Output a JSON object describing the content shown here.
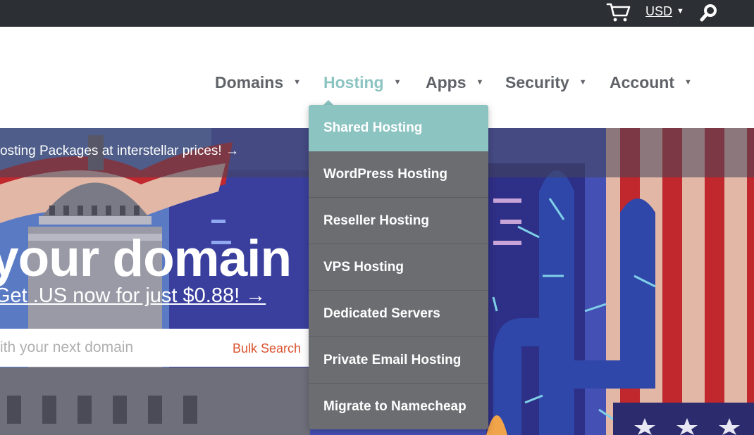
{
  "topbar": {
    "currency": "USD",
    "icons": [
      "cart-icon",
      "chevron-down-icon",
      "search-icon"
    ]
  },
  "nav": {
    "items": [
      {
        "label": "Domains"
      },
      {
        "label": "Hosting"
      },
      {
        "label": "Apps"
      },
      {
        "label": "Security"
      },
      {
        "label": "Account"
      }
    ],
    "active_index": 1
  },
  "hero": {
    "promo": "osting Packages at interstellar prices! →",
    "headline": "your domain",
    "subline": "Get .US now for just $0.88! →",
    "search_placeholder": "ith your next domain",
    "bulk_search": "Bulk Search"
  },
  "dropdown": {
    "items": [
      {
        "label": "Shared Hosting"
      },
      {
        "label": "WordPress Hosting"
      },
      {
        "label": "Reseller Hosting"
      },
      {
        "label": "VPS Hosting"
      },
      {
        "label": "Dedicated Servers"
      },
      {
        "label": "Private Email Hosting"
      },
      {
        "label": "Migrate to Namecheap"
      }
    ],
    "selected_index": 0
  },
  "colors": {
    "topbar": "#2c2f33",
    "accent": "#8cc4c2",
    "dropdown_bg": "#6b6d71",
    "bulk_search": "#d9532f",
    "nav_text": "#5f6368"
  }
}
